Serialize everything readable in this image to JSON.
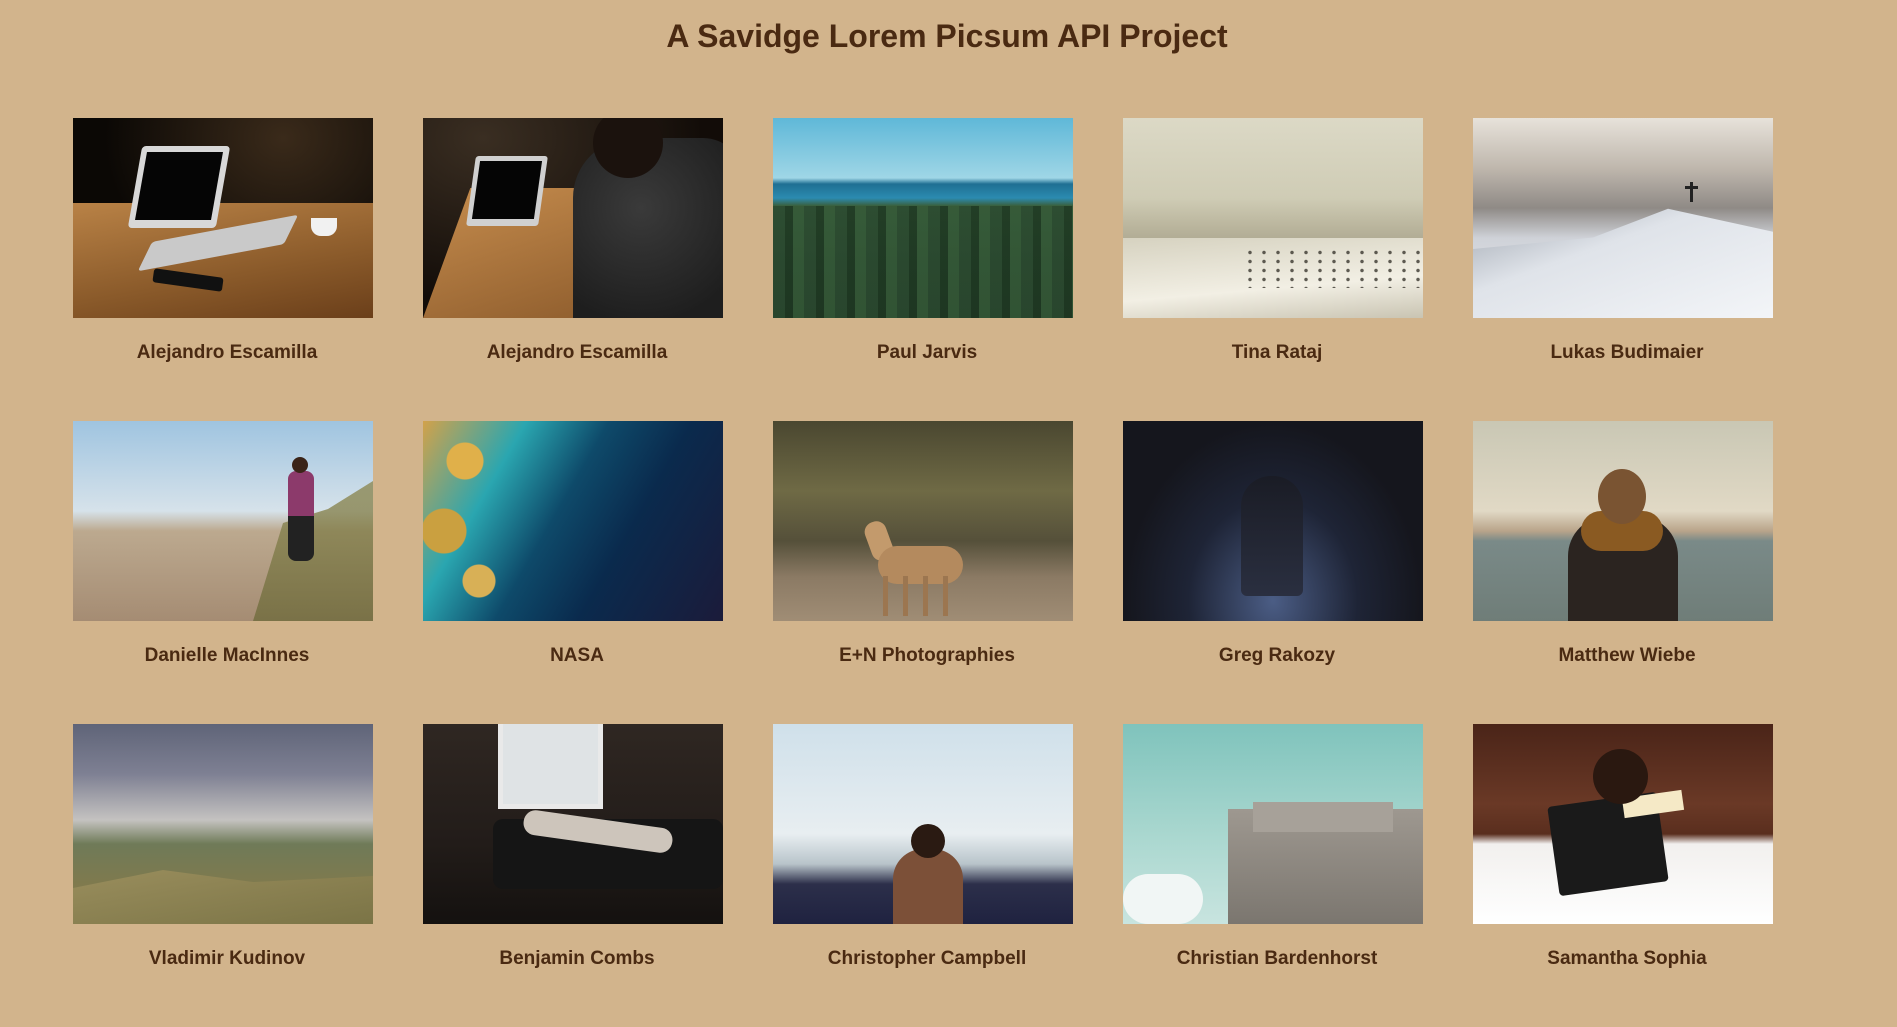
{
  "page": {
    "title": "A Savidge Lorem Picsum API Project"
  },
  "photos": [
    {
      "author": "Alejandro Escamilla",
      "image": "laptop-on-wooden-desk-dark"
    },
    {
      "author": "Alejandro Escamilla",
      "image": "person-typing-on-laptop"
    },
    {
      "author": "Paul Jarvis",
      "image": "forest-overlooking-blue-sea"
    },
    {
      "author": "Tina Rataj",
      "image": "hazy-crowded-beach"
    },
    {
      "author": "Lukas Budimaier",
      "image": "snowy-mountain-summit-cross"
    },
    {
      "author": "Danielle MacInnes",
      "image": "man-carrying-child-on-beach"
    },
    {
      "author": "NASA",
      "image": "aerial-earth-coastline"
    },
    {
      "author": "E+N Photographies",
      "image": "fawn-in-forest"
    },
    {
      "author": "Greg Rakozy",
      "image": "couple-under-light-night"
    },
    {
      "author": "Matthew Wiebe",
      "image": "person-in-scarf-by-sea"
    },
    {
      "author": "Vladimir Kudinov",
      "image": "person-sitting-on-misty-hill"
    },
    {
      "author": "Benjamin Combs",
      "image": "person-sleeping-on-sofa"
    },
    {
      "author": "Christopher Campbell",
      "image": "shirtless-man-by-sea"
    },
    {
      "author": "Christian Bardenhorst",
      "image": "concrete-bunker-building"
    },
    {
      "author": "Samantha Sophia",
      "image": "child-reading-holy-bible"
    }
  ],
  "colors": {
    "background": "#d2b48c",
    "text": "#4a2a12"
  }
}
